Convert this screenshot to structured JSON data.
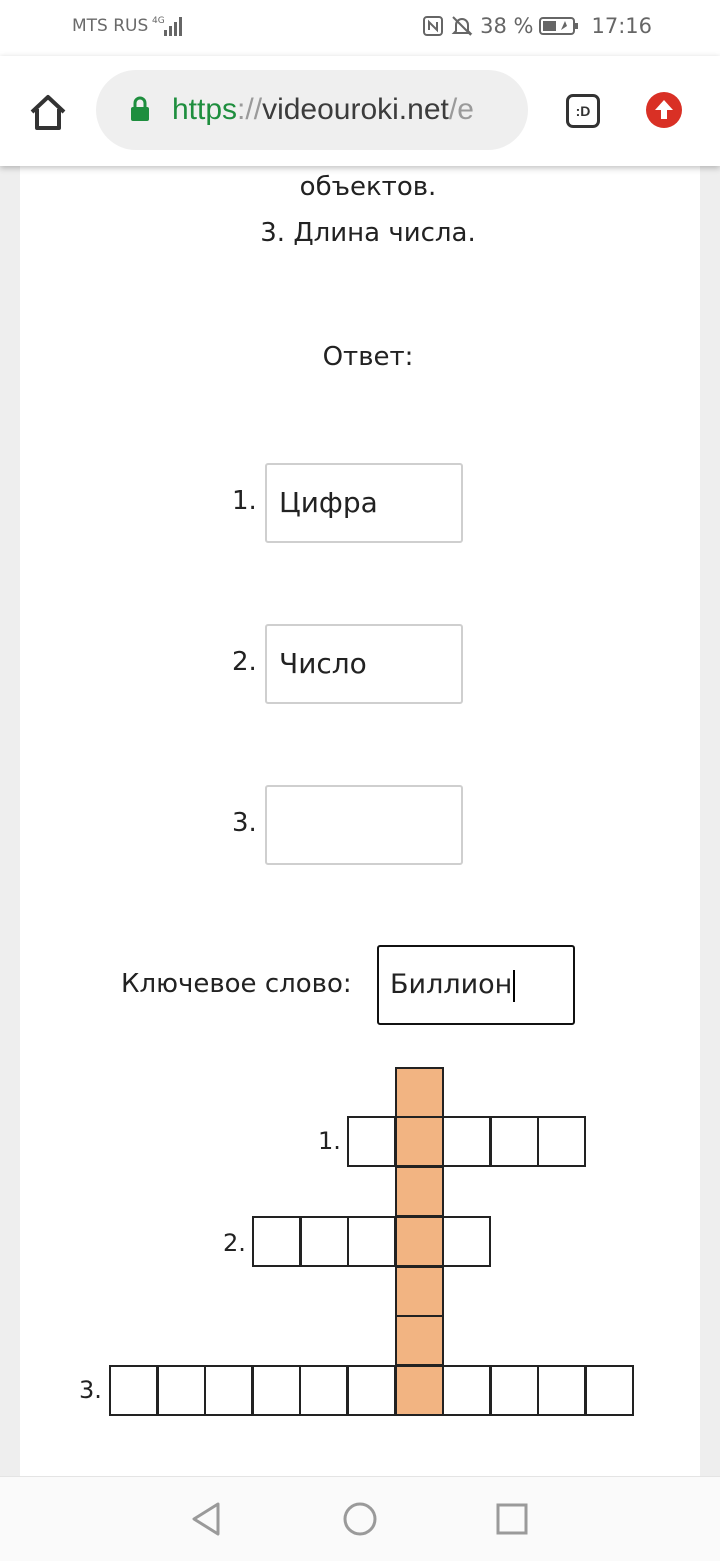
{
  "status_bar": {
    "carrier": "MTS RUS",
    "network": "4G",
    "battery": "38 %",
    "time": "17:16",
    "icons": [
      "nfc-icon",
      "bell-muted-icon",
      "battery-icon",
      "signal-icon"
    ]
  },
  "browser": {
    "url_scheme": "https",
    "url_separator": "://",
    "url_host": "videouroki.net",
    "url_rest": "/e",
    "tabs_label": ":D",
    "icons": [
      "home-icon",
      "lock-icon",
      "tabs-icon",
      "update-icon"
    ]
  },
  "content": {
    "prev_line": "объектов.",
    "question_3": "3. Длина числа.",
    "answer_heading": "Ответ:",
    "answers": [
      {
        "number": "1.",
        "value": "Цифра"
      },
      {
        "number": "2.",
        "value": "Число"
      },
      {
        "number": "3.",
        "value": ""
      }
    ],
    "keyword_label": "Ключевое слово:",
    "keyword_value": "Биллион"
  },
  "crossword": {
    "rows": [
      {
        "number": "1.",
        "cells": 5
      },
      {
        "number": "2.",
        "cells": 5
      },
      {
        "number": "3.",
        "cells": 11
      }
    ],
    "key_color": "#f2b482"
  },
  "nav": {
    "icons": [
      "back-icon",
      "home-circle-icon",
      "recents-icon"
    ]
  }
}
